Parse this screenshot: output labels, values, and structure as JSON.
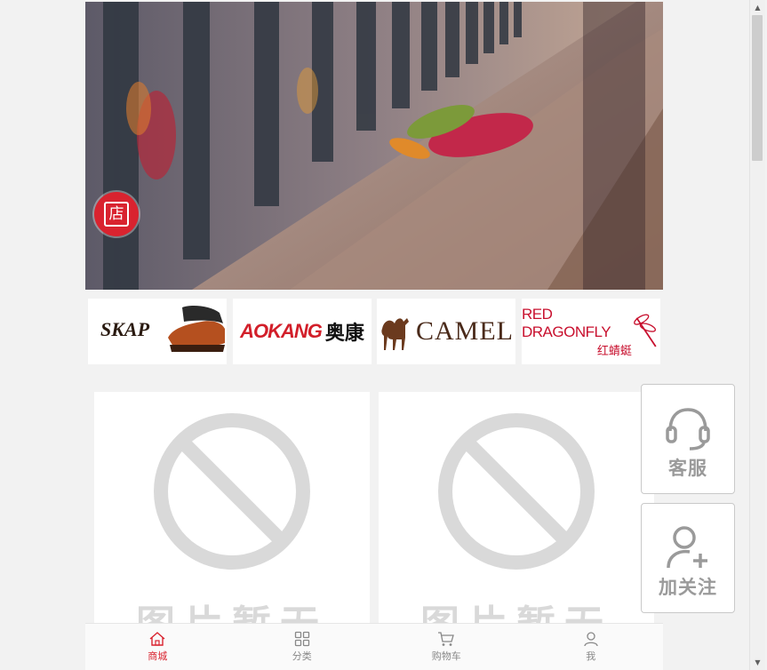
{
  "hero": {
    "shop_badge": {
      "icon": "shop-icon",
      "glyph": "店",
      "color": "#d9232f"
    }
  },
  "brands": [
    {
      "name": "SKAP"
    },
    {
      "name_en": "AOKANG",
      "name_cn": "奥康"
    },
    {
      "name": "CAMEL"
    },
    {
      "name_en": "RED DRAGONFLY",
      "name_cn": "红蜻蜓"
    }
  ],
  "products": [
    {
      "placeholder": "图片暂无"
    },
    {
      "placeholder": "图片暂无"
    }
  ],
  "tabbar": {
    "tabs": [
      {
        "label": "商城",
        "icon": "home-icon",
        "active": true
      },
      {
        "label": "分类",
        "icon": "grid-icon",
        "active": false
      },
      {
        "label": "购物车",
        "icon": "cart-icon",
        "active": false
      },
      {
        "label": "我",
        "icon": "user-icon",
        "active": false
      }
    ]
  },
  "floating": {
    "service": {
      "label": "客服",
      "icon": "headset-icon"
    },
    "follow": {
      "label": "加关注",
      "icon": "user-plus-icon"
    }
  },
  "colors": {
    "accent": "#d9232f",
    "background": "#f2f2f2"
  }
}
